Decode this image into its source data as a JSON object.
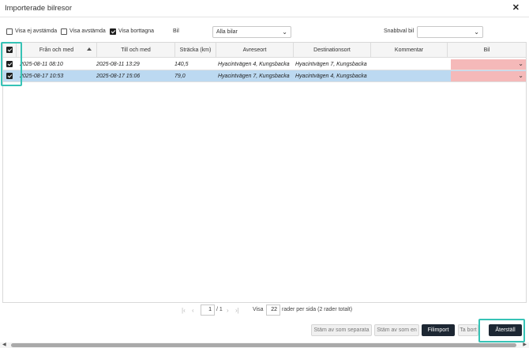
{
  "dialog": {
    "title": "Importerade bilresor"
  },
  "filters": {
    "show_unreconciled": {
      "label": "Visa ej avstämda",
      "checked": false
    },
    "show_reconciled": {
      "label": "Visa avstämda",
      "checked": false
    },
    "show_removed": {
      "label": "Visa borttagna",
      "checked": true
    },
    "car_label": "Bil",
    "car_selected": "Alla bilar",
    "quick_car_label": "Snabbval bil",
    "quick_car_selected": ""
  },
  "table": {
    "columns": [
      "Från och med",
      "Till och med",
      "Sträcka (km)",
      "Avreseort",
      "Destinationsort",
      "Kommentar",
      "Bil"
    ],
    "select_all_checked": true,
    "rows": [
      {
        "checked": true,
        "selected": false,
        "from": "2025-08-11 08:10",
        "to": "2025-08-11 13:29",
        "distance": "140,5",
        "departure": "Hyacintvägen 4, Kungsbacka",
        "destination": "Hyacintvägen 7, Kungsbacka",
        "comment": "",
        "car": ""
      },
      {
        "checked": true,
        "selected": true,
        "from": "2025-08-17 10:53",
        "to": "2025-08-17 15:06",
        "distance": "79,0",
        "departure": "Hyacintvägen 7, Kungsbacka",
        "destination": "Hyacintvägen 4, Kungsbacka",
        "comment": "",
        "car": ""
      }
    ]
  },
  "pager": {
    "page": "1",
    "of": "/ 1",
    "show_label": "Visa",
    "per_page": "22",
    "suffix": "rader per sida (2 rader totalt)"
  },
  "actions": {
    "separate": "Stäm av som separata",
    "as_one": "Stäm av som en",
    "file_import": "Filimport",
    "remove": "Ta bort",
    "restore": "Återställ"
  },
  "colors": {
    "accent_highlight": "#36c3b6",
    "selected_row": "#bcd9f1",
    "car_error": "#f5b9b9",
    "primary_button": "#1d2733"
  }
}
